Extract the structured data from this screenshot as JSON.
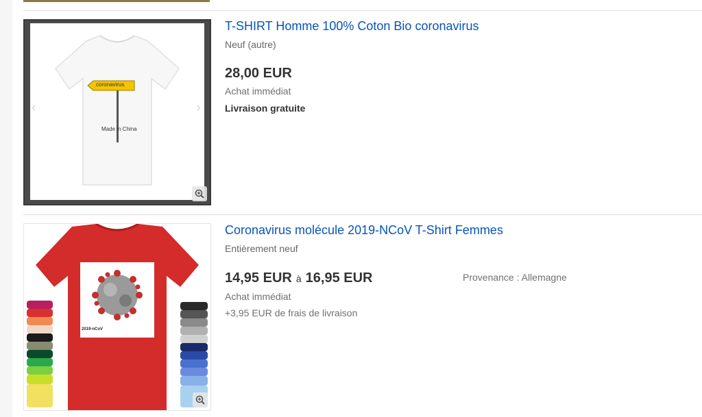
{
  "listings": [
    {
      "title": "T-SHIRT Homme 100% Coton Bio coronavirus",
      "condition": "Neuf (autre)",
      "price": "28,00 EUR",
      "buy_format": "Achat immédiat",
      "shipping": "Livraison gratuite",
      "sign_text": "coronavirus",
      "print_text": "Made in China"
    },
    {
      "title": "Coronavirus molécule 2019-NCoV T-Shirt Femmes",
      "condition": "Entièrement neuf",
      "price_low": "14,95 EUR",
      "price_sep": "à",
      "price_high": "16,95 EUR",
      "buy_format": "Achat immédiat",
      "shipping": "+3,95 EUR de frais de livraison",
      "origin": "Provenance : Allemagne",
      "print_text": "2019-nCoV"
    }
  ],
  "colors": {
    "link": "#0654ba",
    "shirt_red": "#d42b2b",
    "sign_yellow": "#f5c400"
  },
  "icons": [
    "magnifier-plus-icon",
    "chevron-left-icon",
    "chevron-right-icon"
  ]
}
